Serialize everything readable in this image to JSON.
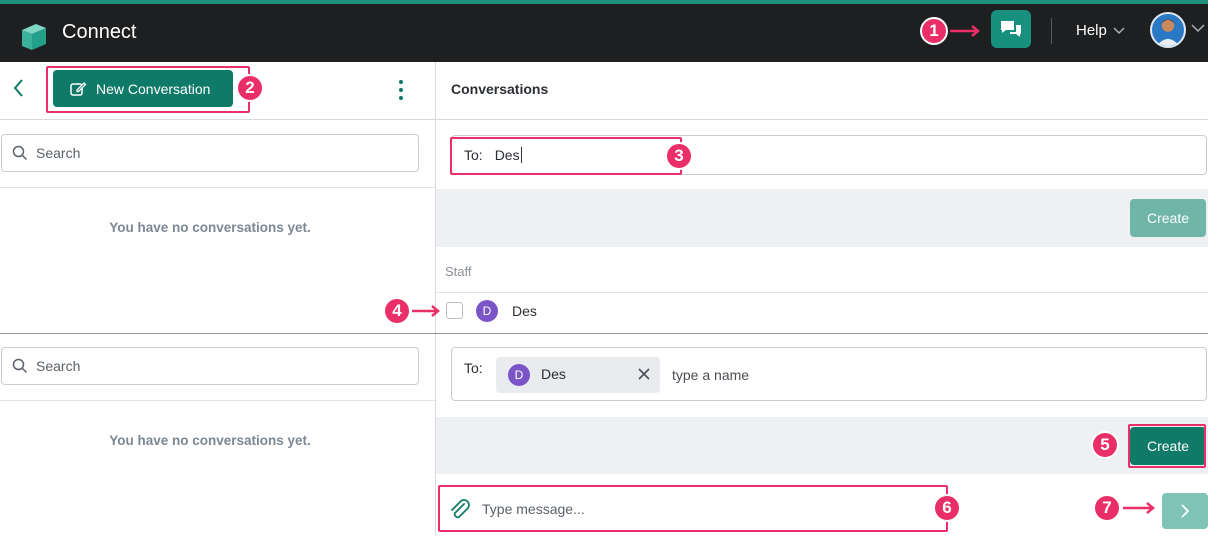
{
  "app": {
    "title": "Connect",
    "help_label": "Help"
  },
  "colors": {
    "brand_green": "#0f7a68",
    "highlight_pink": "#ea2f68",
    "topbar_bg": "#1e1f21"
  },
  "toolbar": {
    "new_conversation_label": "New Conversation",
    "conversations_title": "Conversations"
  },
  "panel_a": {
    "search_placeholder": "Search",
    "empty_text": "You have no conversations yet.",
    "to_label": "To:",
    "to_value": "Des",
    "create_label": "Create",
    "staff_label": "Staff",
    "staff_results": [
      {
        "initial": "D",
        "name": "Des"
      }
    ]
  },
  "panel_b": {
    "search_placeholder": "Search",
    "empty_text": "You have no conversations yet.",
    "to_label": "To:",
    "chip": {
      "initial": "D",
      "name": "Des"
    },
    "name_placeholder": "type a name",
    "create_label": "Create",
    "message_placeholder": "Type message..."
  },
  "callouts": [
    "1",
    "2",
    "3",
    "4",
    "5",
    "6",
    "7"
  ],
  "icons": [
    "logo-icon",
    "chat-bubbles-icon",
    "chevron-down-icon",
    "user-avatar",
    "back-chevron-icon",
    "edit-icon",
    "more-vertical-icon",
    "search-icon",
    "close-icon",
    "paperclip-icon",
    "send-chevron-icon",
    "arrow-right-icon"
  ]
}
